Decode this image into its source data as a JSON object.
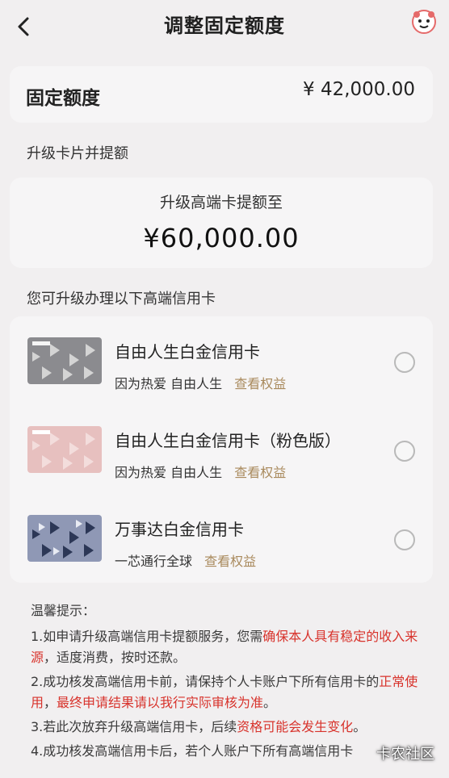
{
  "header": {
    "title": "调整固定额度"
  },
  "fixed_limit": {
    "label": "固定额度",
    "amount": "¥ 42,000.00"
  },
  "upgrade_section": {
    "title": "升级卡片并提额"
  },
  "upgrade_box": {
    "label": "升级高端卡提额至",
    "amount": "¥60,000.00"
  },
  "cards_section": {
    "title": "您可升级办理以下高端信用卡"
  },
  "cards": [
    {
      "name": "自由人生白金信用卡",
      "slogan": "因为热爱 自由人生",
      "link": "查看权益",
      "colors": "#8b8b8f"
    },
    {
      "name": "自由人生白金信用卡（粉色版）",
      "slogan": "因为热爱 自由人生",
      "link": "查看权益",
      "colors": "#e7c0bf"
    },
    {
      "name": "万事达白金信用卡",
      "slogan": "一芯通行全球",
      "link": "查看权益",
      "colors": "#8f98b5"
    }
  ],
  "tips": {
    "title": "温馨提示：",
    "t1_a": "1.如申请升级高端信用卡提额服务，您需",
    "t1_b": "确保本人具有稳定的收入来源",
    "t1_c": "，适度消费，按时还款。",
    "t2_a": "2.成功核发高端信用卡前，请保持个人卡账户下所有信用卡的",
    "t2_b": "正常使用",
    "t2_c": "，",
    "t2_d": "最终申请结果请以我行实际审核为准",
    "t2_e": "。",
    "t3_a": "3.若此次放弃升级高端信用卡，后续",
    "t3_b": "资格可能会发生变化",
    "t3_c": "。",
    "t4": "4.成功核发高端信用卡后，若个人账户下所有高端信用卡"
  },
  "watermark": "卡农社区"
}
